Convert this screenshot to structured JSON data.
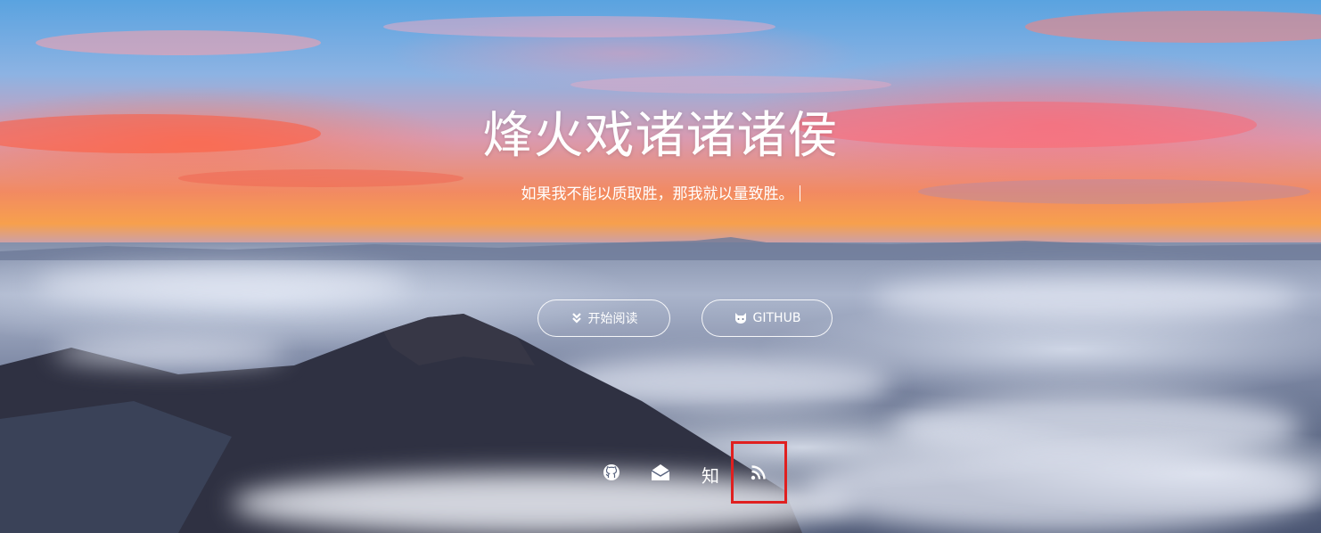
{
  "hero": {
    "title": "烽火戏诸诸诸侯",
    "subtitle": "如果我不能以质取胜，那我就以量致胜。"
  },
  "buttons": {
    "read_label": "开始阅读",
    "read_icon": "double-chevron-down-icon",
    "github_label": "GITHUB",
    "github_icon": "octocat-icon"
  },
  "social": {
    "items": [
      {
        "name": "github",
        "icon": "github-icon"
      },
      {
        "name": "email",
        "icon": "envelope-open-icon"
      },
      {
        "name": "zhihu",
        "text": "知"
      },
      {
        "name": "rss",
        "icon": "rss-icon"
      }
    ]
  },
  "colors": {
    "text": "#ffffff",
    "highlight": "#e02020"
  }
}
